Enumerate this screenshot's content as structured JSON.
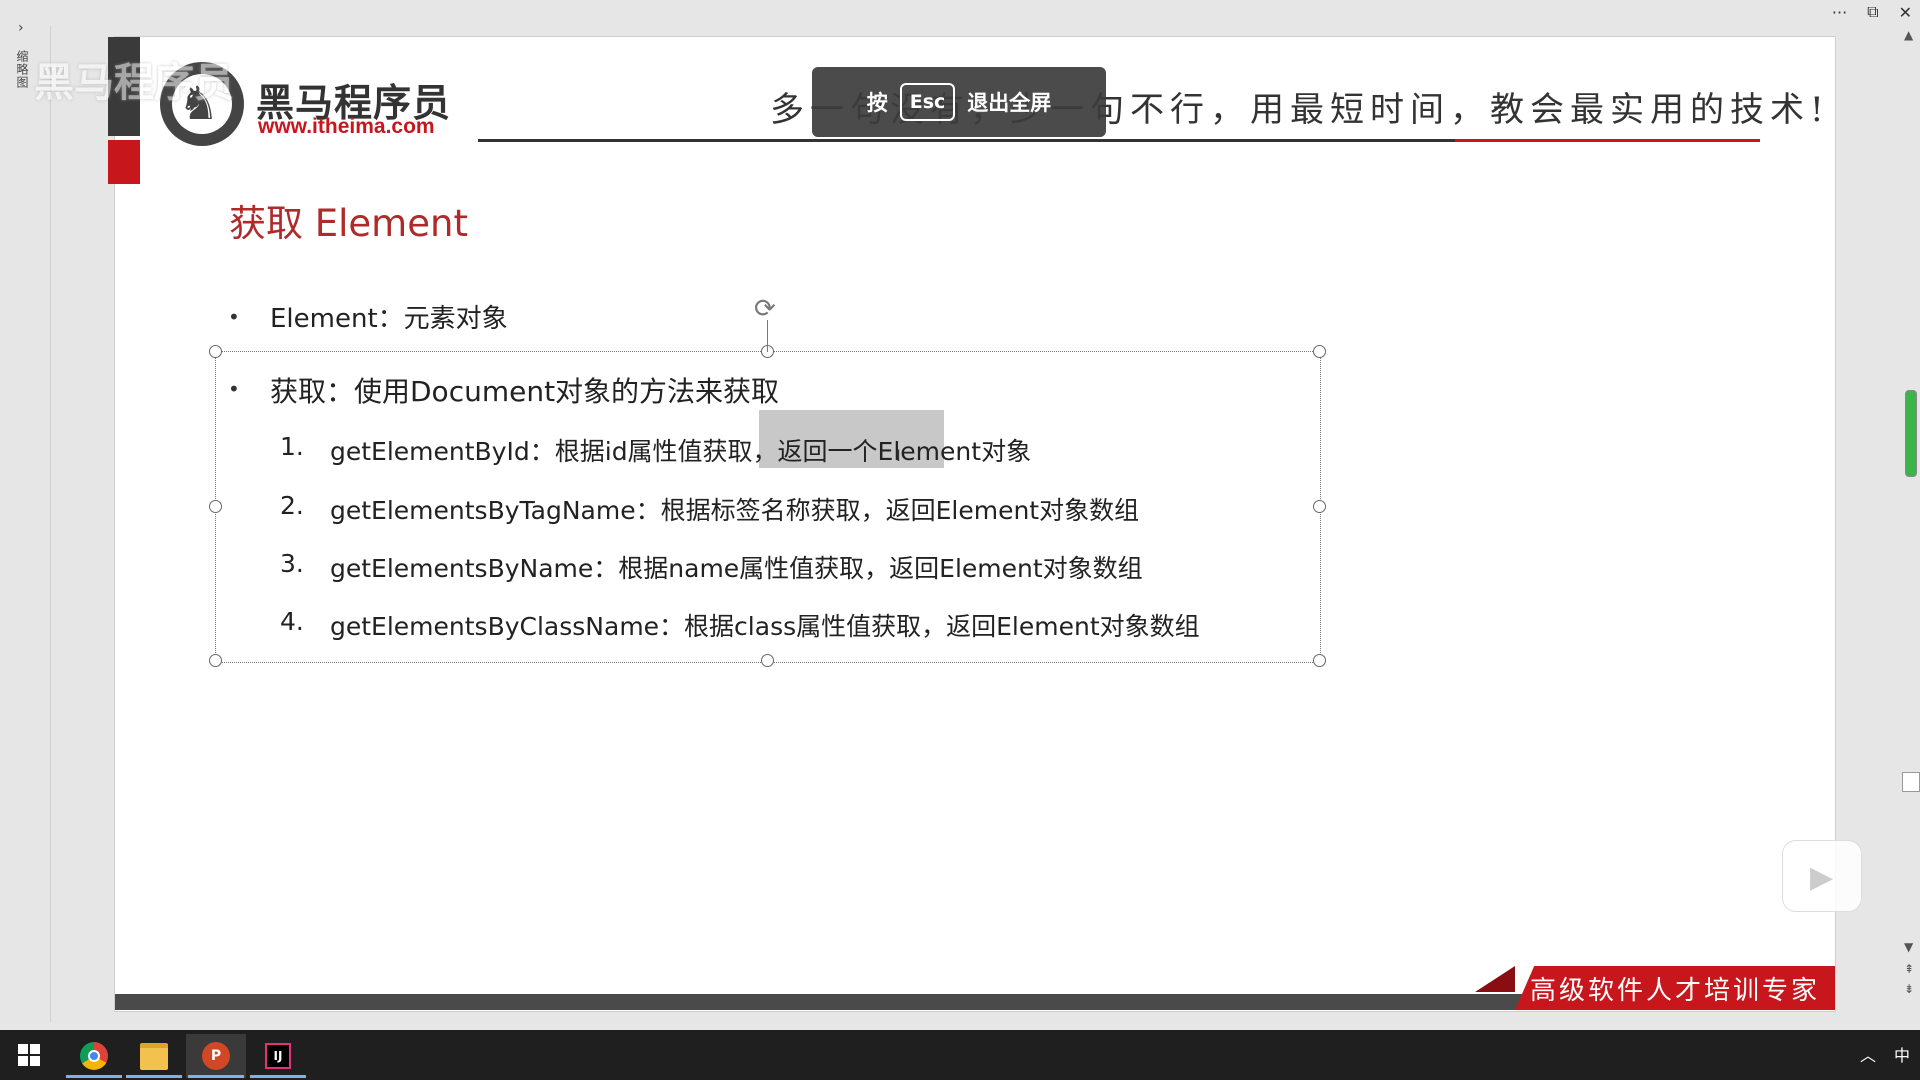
{
  "window": {
    "more_icon": "more-horizontal-icon",
    "more_label": "···",
    "restore_label": "⧉",
    "close_label": "✕"
  },
  "thumbnail_pane": {
    "expand_arrow": "›",
    "label": "缩略图"
  },
  "slide_header": {
    "watermark": "黑马程序员",
    "logo_cn": "黑马程序员",
    "logo_url": "www.itheima.com",
    "slogan": "多一句没有，少一句不行，用最短时间，教会最实用的技术!"
  },
  "esc_overlay": {
    "prefix": "按",
    "key": "Esc",
    "suffix": "退出全屏"
  },
  "slide": {
    "title": "获取 Element",
    "bullet1": "Element：元素对象",
    "bullet2": "获取：使用Document对象的方法来获取",
    "items": [
      {
        "num": "1.",
        "text": "getElementById：根据id属性值获取，返回一个Element对象"
      },
      {
        "num": "2.",
        "text": "getElementsByTagName：根据标签名称获取，返回Element对象数组"
      },
      {
        "num": "3.",
        "text": "getElementsByName：根据name属性值获取，返回Element对象数组"
      },
      {
        "num": "4.",
        "text": "getElementsByClassName：根据class属性值获取，返回Element对象数组"
      }
    ],
    "banner": "高级软件人才培训专家"
  },
  "taskbar": {
    "tray_chevron": "︿",
    "ime": "中",
    "ppt_letter": "P",
    "ij_letter": "IJ"
  },
  "colors": {
    "brand_red": "#c8161d",
    "title_red": "#b02a2a",
    "scroll_thumb": "#3bb54a"
  }
}
